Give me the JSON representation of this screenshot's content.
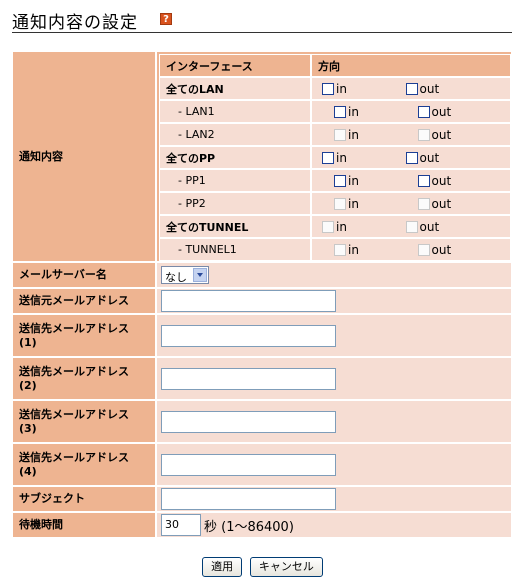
{
  "page": {
    "title": "通知内容の設定",
    "help_icon_glyph": "?"
  },
  "notify": {
    "label": "通知内容",
    "columns": [
      "インターフェース",
      "方向"
    ],
    "in_label": "in",
    "out_label": "out",
    "rows": [
      {
        "name": "全てのLAN",
        "in_enabled": true,
        "out_enabled": true
      },
      {
        "name": "- LAN1",
        "in_enabled": true,
        "out_enabled": true
      },
      {
        "name": "- LAN2",
        "in_enabled": false,
        "out_enabled": false
      },
      {
        "name": "全てのPP",
        "in_enabled": true,
        "out_enabled": true
      },
      {
        "name": "- PP1",
        "in_enabled": true,
        "out_enabled": true
      },
      {
        "name": "- PP2",
        "in_enabled": false,
        "out_enabled": false
      },
      {
        "name": "全てのTUNNEL",
        "in_enabled": false,
        "out_enabled": false
      },
      {
        "name": "- TUNNEL1",
        "in_enabled": false,
        "out_enabled": false
      }
    ]
  },
  "form": {
    "mail_server": {
      "label": "メールサーバー名",
      "selected": "なし"
    },
    "from_address": {
      "label": "送信元メールアドレス",
      "value": ""
    },
    "to_address_1": {
      "label": "送信先メールアドレス",
      "suffix": "(1)",
      "value": ""
    },
    "to_address_2": {
      "label": "送信先メールアドレス",
      "suffix": "(2)",
      "value": ""
    },
    "to_address_3": {
      "label": "送信先メールアドレス",
      "suffix": "(3)",
      "value": ""
    },
    "to_address_4": {
      "label": "送信先メールアドレス",
      "suffix": "(4)",
      "value": ""
    },
    "subject": {
      "label": "サブジェクト",
      "value": ""
    },
    "wait_time": {
      "label": "待機時間",
      "value": "30",
      "unit": "秒 (1〜86400)"
    }
  },
  "buttons": {
    "apply": "適用",
    "cancel": "キャンセル"
  },
  "colors": {
    "label_bg": "#eeb491",
    "value_bg": "#f6ddd3",
    "checkbox_border": "#1c3f95"
  }
}
